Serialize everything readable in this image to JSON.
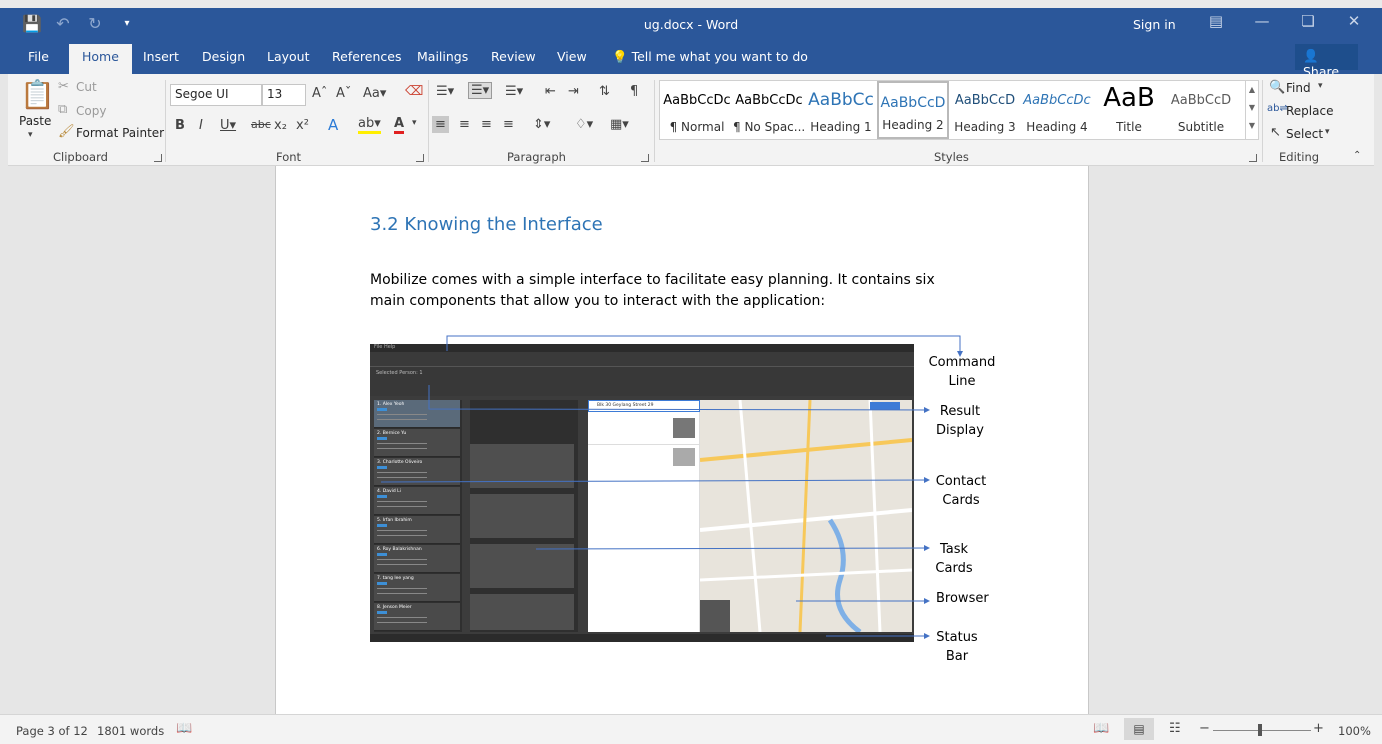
{
  "titlebar": {
    "title": "ug.docx - Word",
    "sign_in": "Sign in",
    "qat": {
      "save_icon": "save-icon",
      "undo_icon": "undo-icon",
      "redo_icon": "redo-icon",
      "customize_icon": "customize-qat-icon"
    }
  },
  "tabs": {
    "file": "File",
    "home": "Home",
    "insert": "Insert",
    "design": "Design",
    "layout": "Layout",
    "references": "References",
    "mailings": "Mailings",
    "review": "Review",
    "view": "View",
    "tell_me": "Tell me what you want to do",
    "share": "Share"
  },
  "clipboard": {
    "label": "Clipboard",
    "paste": "Paste",
    "cut": "Cut",
    "copy": "Copy",
    "format_painter": "Format Painter"
  },
  "font": {
    "label": "Font",
    "font_name": "Segoe UI",
    "font_size": "13"
  },
  "paragraph": {
    "label": "Paragraph"
  },
  "styles": {
    "label": "Styles",
    "items": [
      {
        "sample": "AaBbCcDc",
        "name": "¶ Normal"
      },
      {
        "sample": "AaBbCcDc",
        "name": "¶ No Spac..."
      },
      {
        "sample": "AaBbCc",
        "name": "Heading 1"
      },
      {
        "sample": "AaBbCcD",
        "name": "Heading 2"
      },
      {
        "sample": "AaBbCcD",
        "name": "Heading 3"
      },
      {
        "sample": "AaBbCcDc",
        "name": "Heading 4"
      },
      {
        "sample": "AaB",
        "name": "Title"
      },
      {
        "sample": "AaBbCcD",
        "name": "Subtitle"
      }
    ]
  },
  "editing": {
    "label": "Editing",
    "find": "Find",
    "replace": "Replace",
    "select": "Select"
  },
  "document": {
    "heading": "3.2 Knowing the Interface",
    "paragraph": "Mobilize comes with a simple interface to facilitate easy planning. It contains six main components that allow you to interact with the application:",
    "callouts": {
      "command_line": "Command Line",
      "result_display": "Result Display",
      "contact_cards": "Contact Cards",
      "task_cards": "Task Cards",
      "browser": "Browser",
      "status_bar": "Status Bar"
    },
    "figure": {
      "menu": "File Help",
      "selected_person": "Selected Person: 1",
      "search": "Blk 30 Geylang Street 29",
      "contacts": [
        "1. Alex Yeoh",
        "2. Bernice Yu",
        "3. Charlotte Oliveiro",
        "4. David Li",
        "5. Irfan Ibrahim",
        "6. Roy Balakrishnan",
        "7. tang lee yang",
        "8. Jenson Meier"
      ]
    }
  },
  "statusbar": {
    "page": "Page 3 of 12",
    "words": "1801 words",
    "zoom": "100%"
  }
}
